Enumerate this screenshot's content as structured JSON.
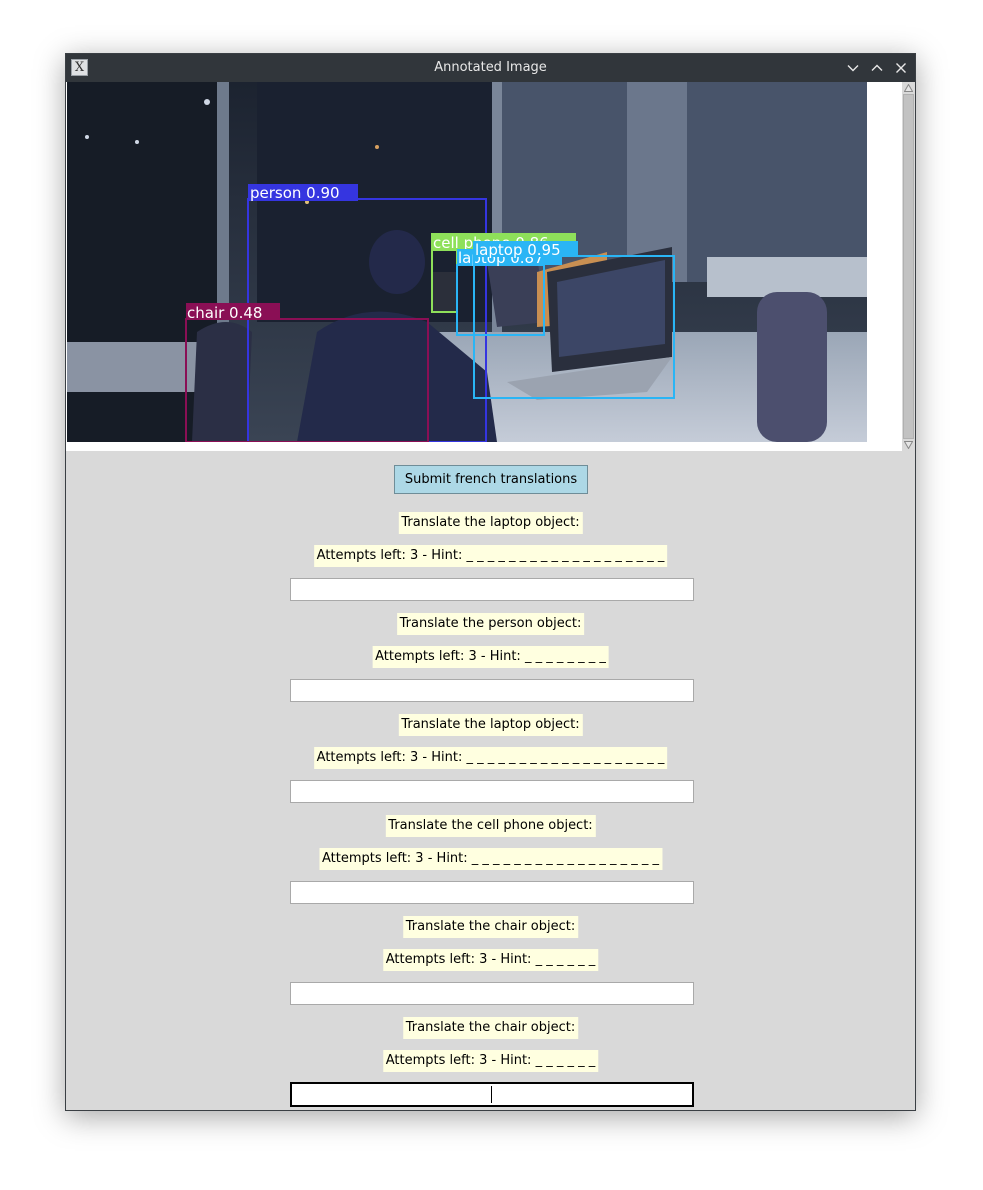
{
  "window": {
    "title": "Annotated Image"
  },
  "photo": {
    "detections": [
      {
        "label": "person 0.90",
        "color": "#3535e0"
      },
      {
        "label": "cell phone 0.86",
        "color": "#8ee05a"
      },
      {
        "label": "laptop 0.95",
        "color": "#2ab5f5"
      },
      {
        "label": "laptop 0.87",
        "color": "#2ab5f5"
      },
      {
        "label": "chair 0.48",
        "color": "#8a0f55"
      }
    ]
  },
  "form": {
    "submit_label": "Submit french translations",
    "items": [
      {
        "prompt": "Translate the laptop object:",
        "attempts": "Attempts left: 3 - Hint: _ _ _ _ _ _ _ _ _ _ _ _ _ _ _ _ _ _ _",
        "value": ""
      },
      {
        "prompt": "Translate the person object:",
        "attempts": "Attempts left: 3 - Hint: _ _ _ _ _ _ _ _",
        "value": ""
      },
      {
        "prompt": "Translate the laptop object:",
        "attempts": "Attempts left: 3 - Hint: _ _ _ _ _ _ _ _ _ _ _ _ _ _ _ _ _ _ _",
        "value": ""
      },
      {
        "prompt": "Translate the cell phone object:",
        "attempts": "Attempts left: 3 - Hint: _ _ _ _ _ _ _ _ _ _ _ _ _ _ _ _ _ _",
        "value": ""
      },
      {
        "prompt": "Translate the chair object:",
        "attempts": "Attempts left: 3 - Hint: _ _ _ _ _ _",
        "value": ""
      },
      {
        "prompt": "Translate the chair object:",
        "attempts": "Attempts left: 3 - Hint: _ _ _ _ _ _",
        "value": ""
      }
    ]
  }
}
